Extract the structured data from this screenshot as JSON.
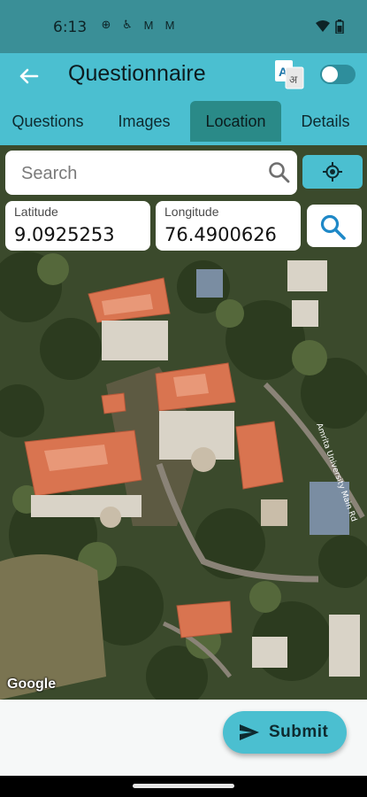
{
  "status_bar": {
    "time": "6:13",
    "icons": [
      "globe-icon",
      "accessibility-icon",
      "gmail-icon",
      "gmail-icon"
    ],
    "right_icons": [
      "wifi-icon",
      "battery-icon"
    ]
  },
  "app_bar": {
    "title": "Questionnaire",
    "translate_icon": "translate-icon",
    "toggle_state": "off"
  },
  "tabs": [
    {
      "label": "Questions",
      "active": false
    },
    {
      "label": "Images",
      "active": false
    },
    {
      "label": "Location",
      "active": true
    },
    {
      "label": "Details",
      "active": false
    }
  ],
  "search": {
    "placeholder": "Search",
    "value": ""
  },
  "coordinates": {
    "latitude_label": "Latitude",
    "latitude_value": "9.0925253",
    "longitude_label": "Longitude",
    "longitude_value": "76.4900626"
  },
  "map": {
    "attribution": "Google"
  },
  "submit": {
    "label": "Submit"
  },
  "colors": {
    "accent": "#4bbfd0",
    "status_bar": "#3a8f97",
    "active_tab": "#2a8a88",
    "icon_blue": "#1e88c7"
  }
}
